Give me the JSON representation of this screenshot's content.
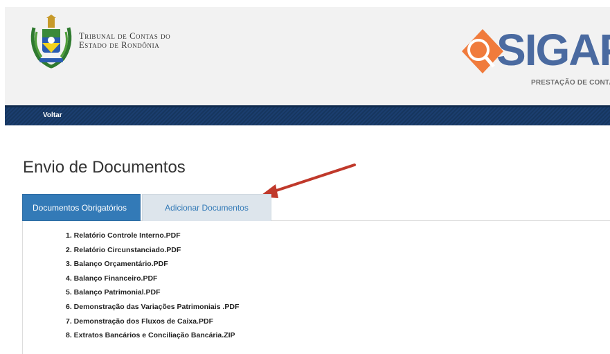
{
  "header": {
    "org_line1": "Tribunal de Contas do",
    "org_line2": "Estado de Rondônia",
    "logo_text": "SIGAP",
    "logo_subtitle": "PRESTAÇÃO DE CONTA",
    "brand_color": "#4a6aa0",
    "logo_accent": "#f07b3c"
  },
  "nav": {
    "back_label": "Voltar"
  },
  "page": {
    "title": "Envio de Documentos"
  },
  "tabs": [
    {
      "label": "Documentos Obrigatórios",
      "active": true
    },
    {
      "label": "Adicionar Documentos",
      "active": false
    }
  ],
  "documents": [
    "1. Relatório Controle Interno.PDF",
    "2. Relatório Circunstanciado.PDF",
    "3. Balanço Orçamentário.PDF",
    "4. Balanço Financeiro.PDF",
    "5. Balanço Patrimonial.PDF",
    "6. Demonstração das Variações Patrimoniais .PDF",
    "7. Demonstração dos Fluxos de Caixa.PDF",
    "8. Extratos Bancários e Conciliação Bancária.ZIP"
  ],
  "colors": {
    "tab_active": "#337ab7",
    "tab_inactive": "#dde5ec",
    "navbar": "#1b3e6f",
    "annotation_arrow": "#c0392b"
  }
}
